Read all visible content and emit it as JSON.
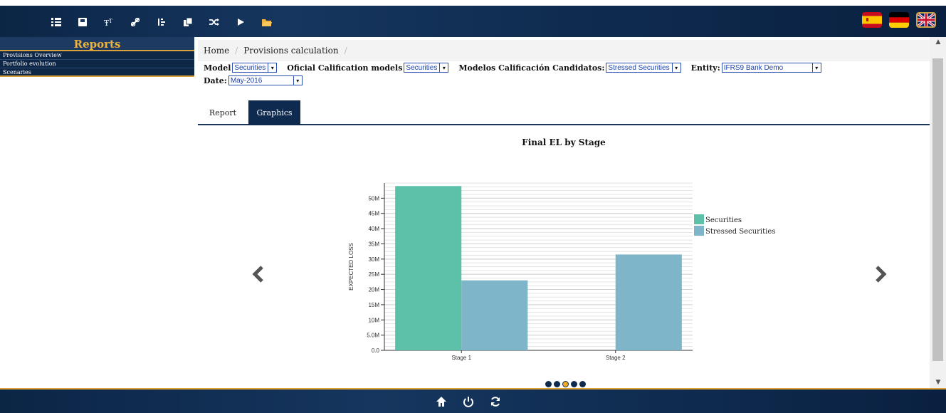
{
  "toolbar": {
    "icons": [
      "list-icon",
      "save-icon",
      "text-size-icon",
      "link-icon",
      "sort-icon",
      "copy-icon",
      "shuffle-icon",
      "play-icon",
      "folder-icon"
    ]
  },
  "flags": [
    "spain-flag",
    "germany-flag",
    "uk-flag"
  ],
  "sidebar": {
    "title": "Reports",
    "items": [
      {
        "label": "Provisions Overview"
      },
      {
        "label": "Portfolio evolution"
      },
      {
        "label": "Scenaries"
      }
    ]
  },
  "breadcrumb": {
    "home": "Home",
    "current": "Provisions calculation"
  },
  "filters": {
    "model_label": "Model",
    "model_value": "Securities",
    "oficial_label": "Oficial Calification models",
    "oficial_value": "Securities",
    "candidatos_label": "Modelos Calificación Candidatos:",
    "candidatos_value": "Stressed Securities",
    "entity_label": "Entity:",
    "entity_value": "IFRS9 Bank Demo",
    "date_label": "Date:",
    "date_value": "May-2016"
  },
  "tabs": [
    {
      "label": "Report"
    },
    {
      "label": "Graphics"
    }
  ],
  "carousel": {
    "slides": 5,
    "active_index": 2
  },
  "colors": {
    "navy": "#0e2a4f",
    "gold": "#d9a23a",
    "securities": "#5dc0a8",
    "stressed": "#7fb5c8"
  },
  "chart_data": {
    "type": "bar",
    "title": "Final EL by Stage",
    "xlabel": "",
    "ylabel": "EXPECTED LOSS",
    "categories": [
      "Stage 1",
      "Stage 2"
    ],
    "series": [
      {
        "name": "Securities",
        "values": [
          54,
          0
        ]
      },
      {
        "name": "Stressed Securities",
        "values": [
          23,
          31.5
        ]
      }
    ],
    "ylim": [
      0,
      55
    ],
    "yticks": [
      0,
      5,
      10,
      15,
      20,
      25,
      30,
      35,
      40,
      45,
      50
    ],
    "ytick_labels": [
      "0.0",
      "5.0M",
      "10M",
      "15M",
      "20M",
      "25M",
      "30M",
      "35M",
      "40M",
      "45M",
      "50M"
    ],
    "grid": true,
    "legend_position": "right"
  },
  "footer": {
    "icons": [
      "home-icon",
      "power-icon",
      "refresh-icon"
    ]
  }
}
